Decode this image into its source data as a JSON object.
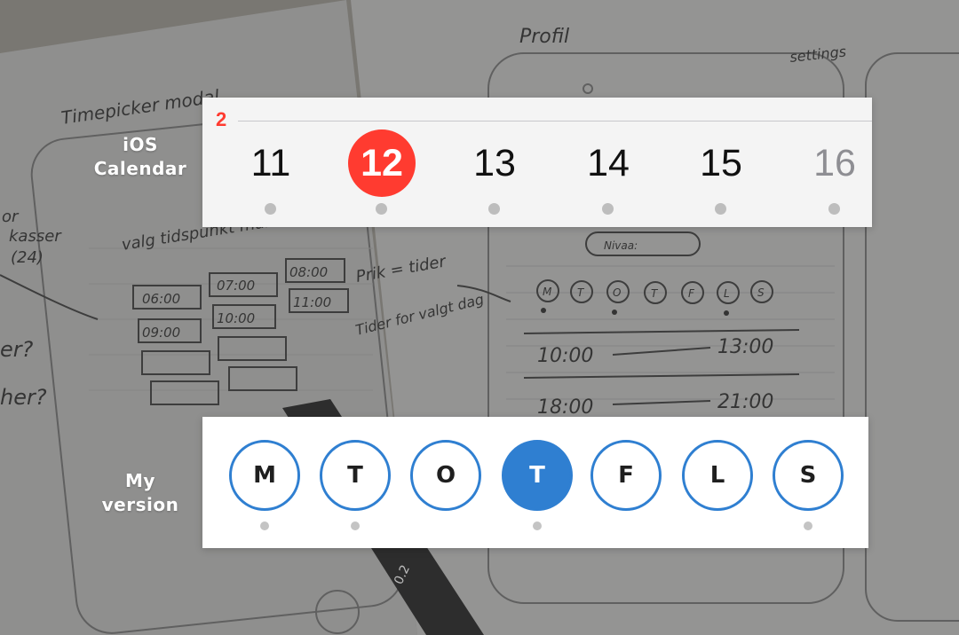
{
  "labels": {
    "ios_line1": "iOS",
    "ios_line2": "Calendar",
    "mine_line1": "My",
    "mine_line2": "version"
  },
  "ios_calendar": {
    "month_marker": "2",
    "accent_color": "#ff3b30",
    "days": [
      {
        "label": "11",
        "has_event": true,
        "selected": false,
        "dim": false
      },
      {
        "label": "12",
        "has_event": true,
        "selected": true,
        "dim": false
      },
      {
        "label": "13",
        "has_event": true,
        "selected": false,
        "dim": false
      },
      {
        "label": "14",
        "has_event": true,
        "selected": false,
        "dim": false
      },
      {
        "label": "15",
        "has_event": true,
        "selected": false,
        "dim": false
      },
      {
        "label": "16",
        "has_event": true,
        "selected": false,
        "dim": true
      }
    ]
  },
  "my_version": {
    "accent_color": "#2f7fd1",
    "days": [
      {
        "label": "M",
        "has_event": true,
        "selected": false
      },
      {
        "label": "T",
        "has_event": true,
        "selected": false
      },
      {
        "label": "O",
        "has_event": false,
        "selected": false
      },
      {
        "label": "T",
        "has_event": true,
        "selected": true
      },
      {
        "label": "F",
        "has_event": false,
        "selected": false
      },
      {
        "label": "L",
        "has_event": false,
        "selected": false
      },
      {
        "label": "S",
        "has_event": true,
        "selected": false
      }
    ]
  },
  "background_sketch": {
    "texts": [
      "Timepicker modal",
      "Profil",
      "settings",
      "valg tidspunkt mandag",
      "06:00",
      "07:00",
      "08:00",
      "09:00",
      "10:00",
      "11:00",
      "Prik = tider",
      "Tider for valgt dag",
      "Nivaa:",
      "10:00",
      "13:00",
      "18:00",
      "21:00",
      "M",
      "T",
      "O",
      "T",
      "F",
      "L",
      "S",
      "or",
      "kasser",
      "(24)",
      "er?",
      "her?",
      "0.2"
    ]
  }
}
